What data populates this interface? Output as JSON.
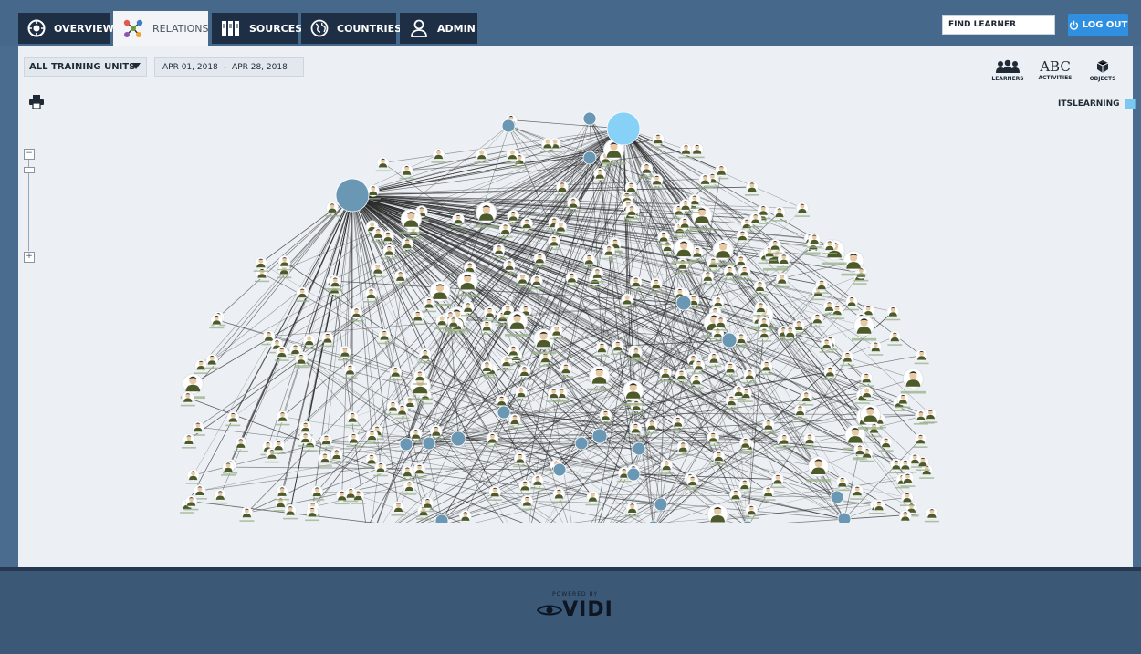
{
  "nav": {
    "tabs": [
      {
        "label": "OVERVIEW",
        "icon": "overview-icon",
        "active": false
      },
      {
        "label": "RELATIONS",
        "icon": "relations-icon",
        "active": true
      },
      {
        "label": "SOURCES",
        "icon": "sources-icon",
        "active": false
      },
      {
        "label": "COUNTRIES",
        "icon": "globe-icon",
        "active": false
      },
      {
        "label": "ADMIN",
        "icon": "admin-user-icon",
        "active": false
      }
    ],
    "find_learner_placeholder": "FIND LEARNER",
    "logout_label": "LOG OUT"
  },
  "filters": {
    "training_units": "ALL TRAINING UNITS",
    "date_from": "APR 01, 2018",
    "date_sep": "-",
    "date_to": "APR 28, 2018"
  },
  "view_toggles": {
    "learners": "LEARNERS",
    "activities": "ACTIVITIES",
    "activities_glyph": "ABC",
    "objects": "OBJECTS"
  },
  "legend": {
    "source_label": "ITSLEARNING",
    "source_color": "#7ac7ef"
  },
  "graph": {
    "hub_color": "#6a97b4",
    "highlight_hub_color": "#86d1f5",
    "learner_icon": "learner-avatar-icon",
    "edge_color": "#2b2b2b"
  },
  "footer": {
    "powered_by": "POWERED BY",
    "brand": "VIDI"
  },
  "colors": {
    "nav_bg": "#46688b",
    "tab_bg": "#1e2e45",
    "panel_bg": "#ecf0f4",
    "logout_bg": "#2f8fe0",
    "footer_bg": "#3c5877"
  }
}
